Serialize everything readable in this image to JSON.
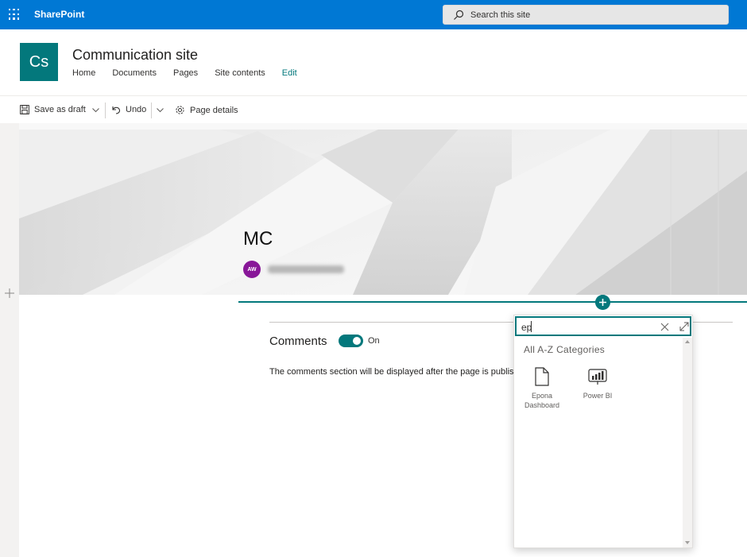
{
  "suite_bar": {
    "app_name": "SharePoint",
    "search_placeholder": "Search this site",
    "color": "#0078d4"
  },
  "site": {
    "logo_initials": "Cs",
    "logo_color": "#03787c",
    "title": "Communication site",
    "nav": [
      "Home",
      "Documents",
      "Pages",
      "Site contents",
      "Edit"
    ]
  },
  "command_bar": {
    "save_label": "Save as draft",
    "undo_label": "Undo",
    "page_details_label": "Page details"
  },
  "hero": {
    "title": "MC",
    "author_initials": "AW"
  },
  "comments": {
    "label": "Comments",
    "toggle_state": "On",
    "note": "The comments section will be displayed after the page is published."
  },
  "toolbox": {
    "search_value": "ep",
    "heading": "All A-Z Categories",
    "items": [
      {
        "label": "Epona Dashboard",
        "icon": "page-icon"
      },
      {
        "label": "Power BI",
        "icon": "power-bi-icon"
      }
    ]
  }
}
